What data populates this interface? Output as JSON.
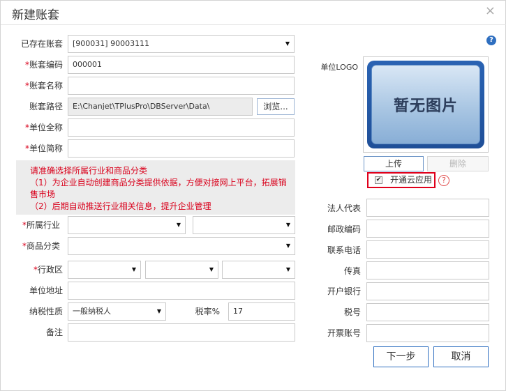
{
  "dialog": {
    "title": "新建账套",
    "close_glyph": "×",
    "help_glyph": "?"
  },
  "form": {
    "existing_account": {
      "label": "已存在账套",
      "value": "[900031] 90003111"
    },
    "account_code": {
      "required_mark": "*",
      "label": "账套编码",
      "value": "000001"
    },
    "account_name": {
      "required_mark": "*",
      "label": "账套名称",
      "value": ""
    },
    "account_path": {
      "label": "账套路径",
      "value": "E:\\Chanjet\\TPlusPro\\DBServer\\Data\\",
      "browse_label": "浏览..."
    },
    "company_full_name": {
      "required_mark": "*",
      "label": "单位全称",
      "value": ""
    },
    "company_short_name": {
      "required_mark": "*",
      "label": "单位简称",
      "value": ""
    },
    "notice": {
      "line1": "请准确选择所属行业和商品分类",
      "line2": "（1）为企业自动创建商品分类提供依据，方便对接网上平台，拓展销售市场",
      "line3": "（2）后期自动推送行业相关信息，提升企业管理"
    },
    "industry": {
      "required_mark": "*",
      "label": "所属行业",
      "value1": "",
      "value2": ""
    },
    "product_category": {
      "required_mark": "*",
      "label": "商品分类",
      "value": ""
    },
    "region": {
      "required_mark": "*",
      "label": "行政区",
      "value1": "",
      "value2": "",
      "value3": ""
    },
    "address": {
      "label": "单位地址",
      "value": ""
    },
    "tax_nature": {
      "label": "纳税性质",
      "value": "一般纳税人"
    },
    "tax_rate": {
      "label": "税率%",
      "value": "17"
    },
    "remarks": {
      "label": "备注",
      "value": ""
    }
  },
  "right_panel": {
    "logo_label": "单位LOGO",
    "logo_placeholder": "暂无图片",
    "upload_label": "上传",
    "delete_label": "删除",
    "cloud_label": "开通云应用",
    "cloud_checked": true,
    "cloud_checkmark": "✔",
    "cloud_help": "?",
    "legal_rep": {
      "label": "法人代表",
      "value": ""
    },
    "postal_code": {
      "label": "邮政编码",
      "value": ""
    },
    "phone": {
      "label": "联系电话",
      "value": ""
    },
    "fax": {
      "label": "传真",
      "value": ""
    },
    "bank": {
      "label": "开户银行",
      "value": ""
    },
    "tax_number": {
      "label": "税号",
      "value": ""
    },
    "invoice_account": {
      "label": "开票账号",
      "value": ""
    }
  },
  "buttons": {
    "next_label": "下一步",
    "cancel_label": "取消"
  },
  "glyphs": {
    "dropdown_arrow": "▼"
  },
  "colors": {
    "required": "#d9001b",
    "accent": "#2f6fc0",
    "highlight_border": "#e0001b"
  }
}
